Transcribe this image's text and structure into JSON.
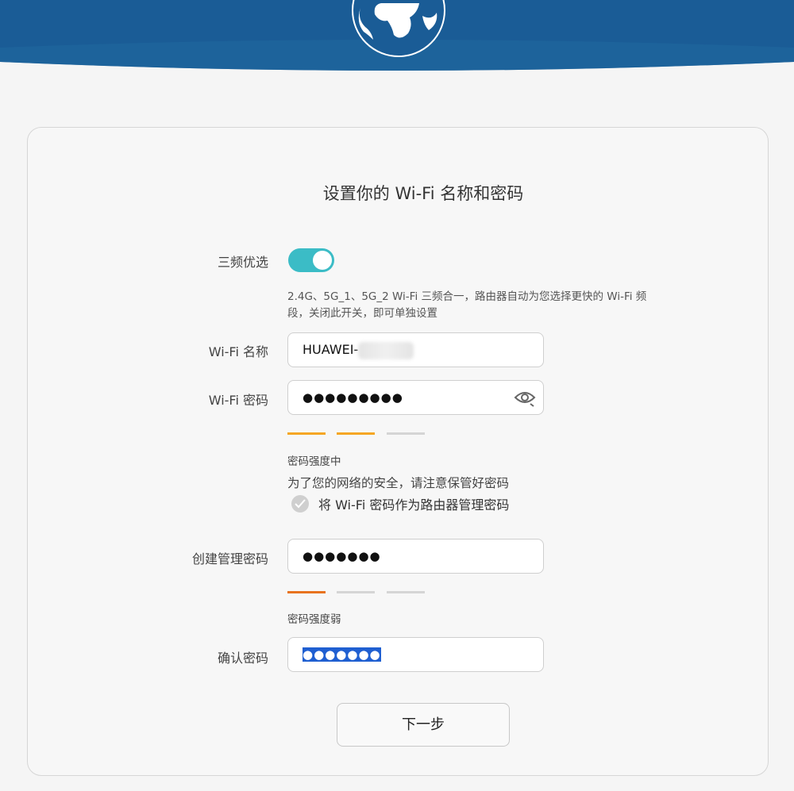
{
  "colors": {
    "header_blue": "#1a5c96",
    "toggle_on": "#3bbcc6",
    "strength_orange": "#f5a623",
    "strength_weak": "#e8731e",
    "strength_inactive": "#d5d5d5",
    "selection_blue": "#1f5fd1"
  },
  "header": {
    "logo_icon": "globe-icon"
  },
  "form": {
    "title": "设置你的 Wi-Fi 名称和密码",
    "tri_band": {
      "label": "三频优选",
      "enabled": true,
      "description": "2.4G、5G_1、5G_2 Wi-Fi 三频合一，路由器自动为您选择更快的 Wi-Fi 频段，关闭此开关，即可单独设置"
    },
    "wifi_name": {
      "label": "Wi-Fi 名称",
      "value": "HUAWEI-"
    },
    "wifi_password": {
      "label": "Wi-Fi 密码",
      "value": "●●●●●●●●●",
      "toggle_icon": "eye-hidden-icon",
      "strength_level": 2,
      "strength_max": 3,
      "strength_text": "密码强度中",
      "security_note": "为了您的网络的安全，请注意保管好密码",
      "use_as_admin_label": "将 Wi-Fi 密码作为路由器管理密码",
      "use_as_admin_checked": false
    },
    "admin_password": {
      "label": "创建管理密码",
      "value": "●●●●●●●",
      "strength_level": 1,
      "strength_max": 3,
      "strength_text": "密码强度弱"
    },
    "confirm_password": {
      "label": "确认密码",
      "value": "●●●●●●●"
    },
    "next_button": "下一步"
  }
}
